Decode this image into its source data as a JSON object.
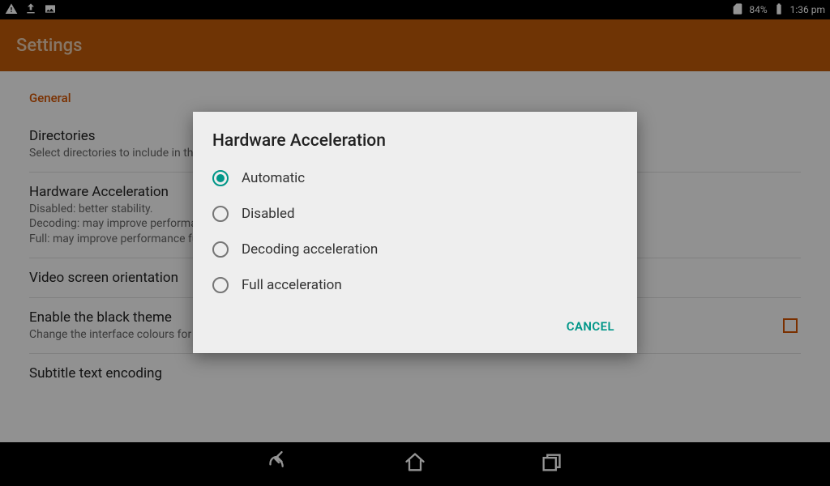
{
  "statusbar": {
    "battery_pct": "84%",
    "clock": "1:36 pm"
  },
  "appbar": {
    "title": "Settings"
  },
  "section": {
    "general": "General"
  },
  "items": {
    "directories": {
      "title": "Directories",
      "sub": "Select directories to include in the media library"
    },
    "hwaccel": {
      "title": "Hardware Acceleration",
      "sub": "Disabled: better stability.\nDecoding: may improve performance.\nFull: may improve performance further."
    },
    "orientation": {
      "title": "Video screen orientation"
    },
    "blacktheme": {
      "title": "Enable the black theme",
      "sub": "Change the interface colours for better comfort in low light environments.",
      "checked": false
    },
    "subtitle": {
      "title": "Subtitle text encoding"
    }
  },
  "dialog": {
    "title": "Hardware Acceleration",
    "options": {
      "auto": "Automatic",
      "disabled": "Disabled",
      "decode": "Decoding acceleration",
      "full": "Full acceleration"
    },
    "selected": "auto",
    "cancel": "CANCEL"
  }
}
